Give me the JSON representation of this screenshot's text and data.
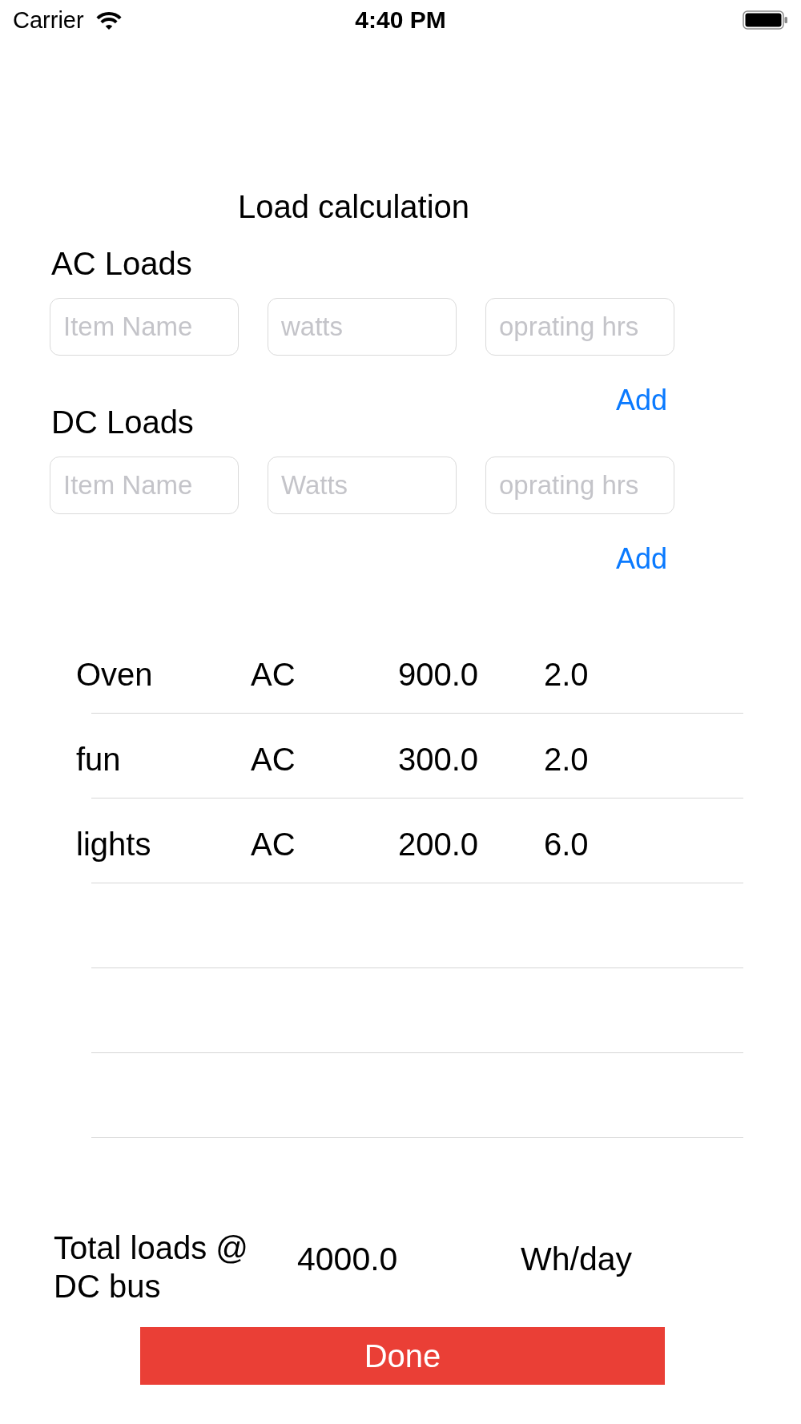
{
  "status_bar": {
    "carrier": "Carrier",
    "time": "4:40 PM"
  },
  "title": "Load calculation",
  "sections": [
    {
      "heading": "AC Loads",
      "fields": [
        {
          "placeholder": "Item Name"
        },
        {
          "placeholder": "watts"
        },
        {
          "placeholder": "oprating hrs"
        }
      ],
      "add_button": "Add"
    },
    {
      "heading": "DC Loads",
      "fields": [
        {
          "placeholder": "Item Name"
        },
        {
          "placeholder": "Watts"
        },
        {
          "placeholder": "oprating hrs"
        }
      ],
      "add_button": "Add"
    }
  ],
  "table": {
    "rows": [
      {
        "cells": [
          "Oven",
          "AC",
          "900.0",
          "2.0"
        ]
      },
      {
        "cells": [
          "fun",
          "AC",
          "300.0",
          "2.0"
        ]
      },
      {
        "cells": [
          "lights",
          "AC",
          "200.0",
          "6.0"
        ]
      }
    ]
  },
  "total": {
    "label": "Total loads @ DC bus",
    "value": "4000.0",
    "unit": "Wh/day"
  },
  "done_button": "Done"
}
